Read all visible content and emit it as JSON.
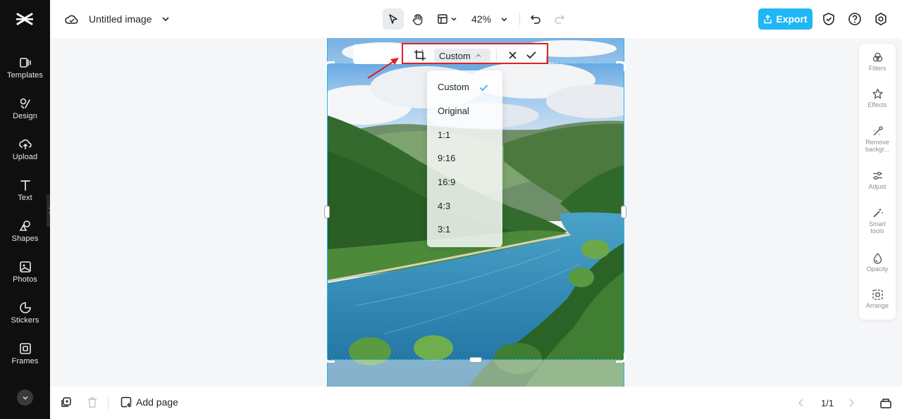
{
  "sidebar": {
    "items": [
      {
        "label": "Templates",
        "icon": "templates-icon"
      },
      {
        "label": "Design",
        "icon": "design-icon"
      },
      {
        "label": "Upload",
        "icon": "upload-icon"
      },
      {
        "label": "Text",
        "icon": "text-icon"
      },
      {
        "label": "Shapes",
        "icon": "shapes-icon"
      },
      {
        "label": "Photos",
        "icon": "photos-icon"
      },
      {
        "label": "Stickers",
        "icon": "stickers-icon"
      },
      {
        "label": "Frames",
        "icon": "frames-icon"
      }
    ]
  },
  "header": {
    "title": "Untitled image",
    "zoom": "42%",
    "export_label": "Export"
  },
  "crop": {
    "selected_ratio": "Custom",
    "options": [
      "Custom",
      "Original",
      "1:1",
      "9:16",
      "16:9",
      "4:3",
      "3:1"
    ]
  },
  "right_panel": {
    "items": [
      {
        "label": "Filters"
      },
      {
        "label": "Effects"
      },
      {
        "label": "Remove backgr..."
      },
      {
        "label": "Adjust"
      },
      {
        "label": "Smart tools"
      },
      {
        "label": "Opacity"
      },
      {
        "label": "Arrange"
      }
    ]
  },
  "footer": {
    "add_page_label": "Add page",
    "page_indicator": "1/1"
  },
  "colors": {
    "accent": "#1fb7f5",
    "sidebar_bg": "#0f0f10",
    "highlight_outline": "#e02020"
  }
}
